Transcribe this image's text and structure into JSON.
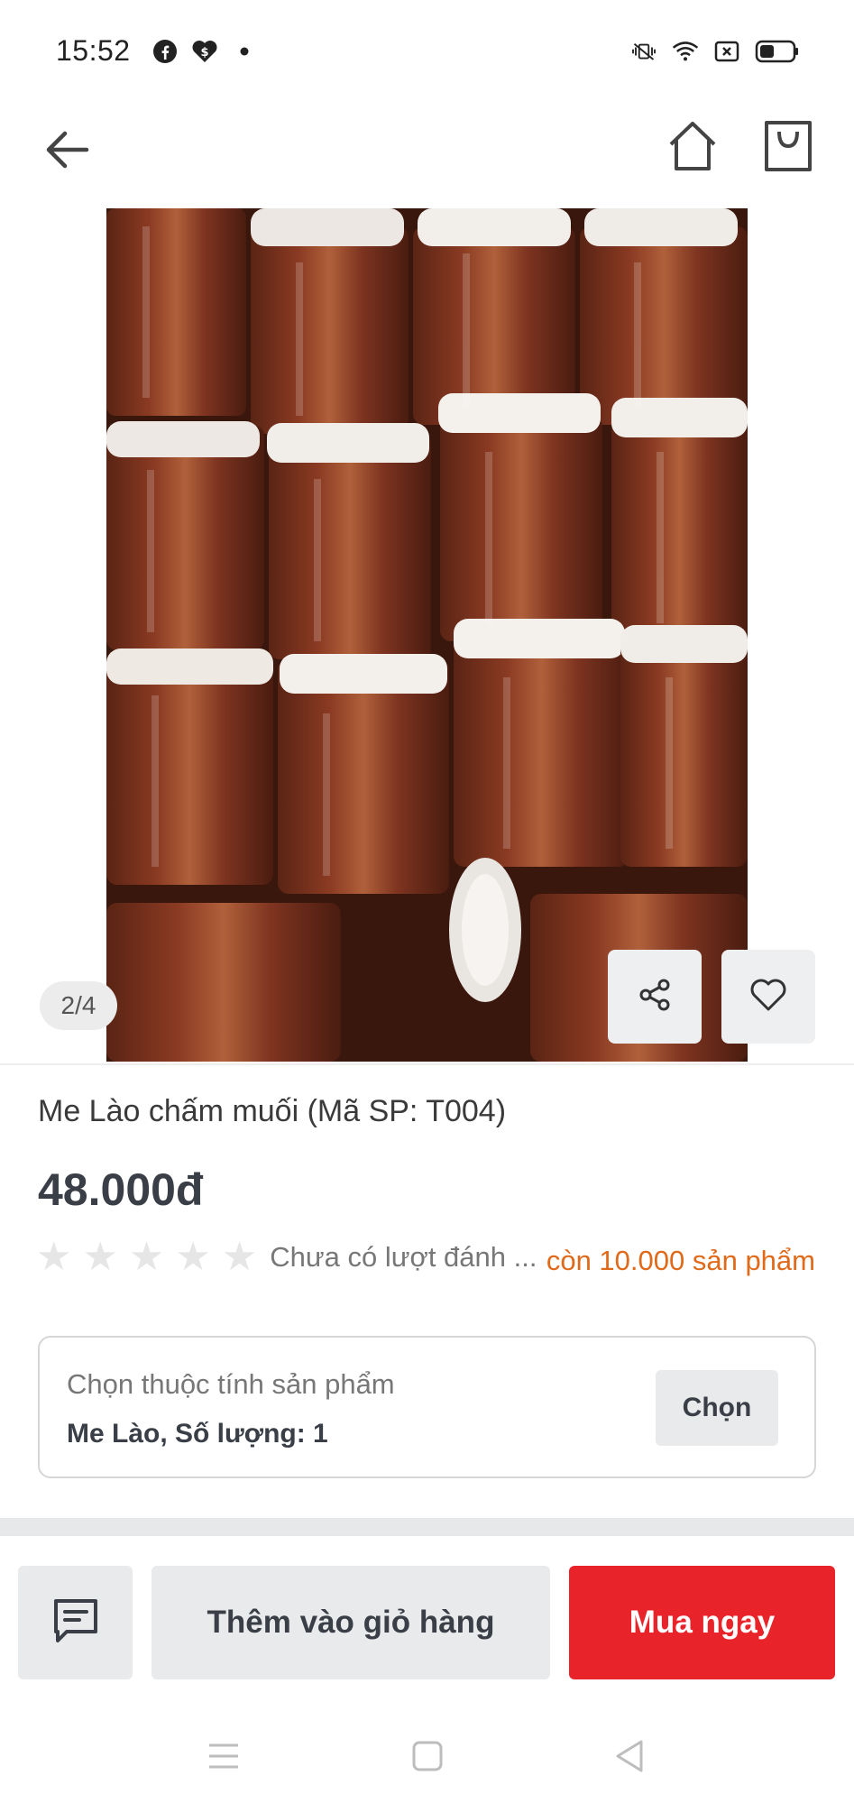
{
  "status_bar": {
    "time": "15:52",
    "left_icons": [
      "facebook-icon",
      "messenger-dollar-icon",
      "dot-icon"
    ],
    "right_icons": [
      "vibrate-icon",
      "wifi-icon",
      "sim-icon",
      "battery-icon"
    ]
  },
  "nav": {
    "icons": [
      "back-arrow-icon",
      "home-icon",
      "shopping-bag-icon"
    ]
  },
  "image": {
    "counter": "2/4",
    "actions": [
      "share-icon",
      "heart-icon"
    ]
  },
  "product": {
    "title": "Me Lào chấm muối (Mã SP: T004)",
    "price": "48.000đ",
    "rating_stars": 0,
    "rating_text": "Chưa có lượt đánh ...",
    "stock_text": "còn 10.000 sản phẩm"
  },
  "attributes": {
    "label": "Chọn thuộc tính sản phẩm",
    "value": "Me Lào, Số lượng: 1",
    "choose_label": "Chọn"
  },
  "actions": {
    "chat_icon": "chat-icon",
    "add_to_cart": "Thêm vào giỏ hàng",
    "buy_now": "Mua ngay"
  },
  "colors": {
    "buy_button": "#e8232a",
    "stock_text": "#e06a1a",
    "button_gray": "#e9eaec"
  },
  "system_nav": [
    "menu-icon",
    "square-home-icon",
    "triangle-back-icon"
  ]
}
